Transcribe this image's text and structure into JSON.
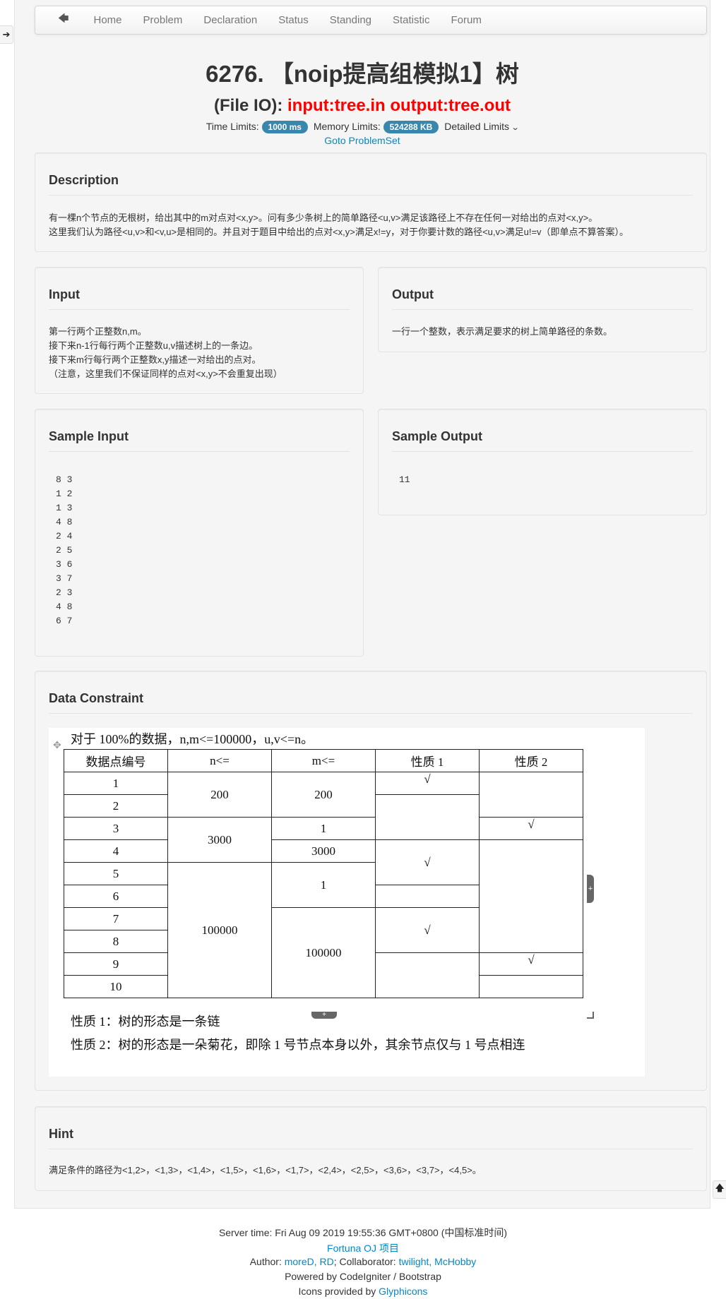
{
  "nav": {
    "back_icon": "arrow-left-icon",
    "items": [
      "Home",
      "Problem",
      "Declaration",
      "Status",
      "Standing",
      "Statistic",
      "Forum"
    ]
  },
  "side": {
    "left_icon": "arrow-right-icon",
    "right_icon": "arrow-up-icon"
  },
  "header": {
    "title": "6276. 【noip提高组模拟1】树",
    "fileio_prefix": "(File IO): ",
    "fileio_value": "input:tree.in output:tree.out",
    "time_label": "Time Limits:",
    "time_value": "1000 ms",
    "memory_label": "Memory Limits:",
    "memory_value": "524288 KB",
    "detailed_label": "Detailed Limits",
    "goto": "Goto ProblemSet"
  },
  "description": {
    "heading": "Description",
    "lines": [
      "有一棵n个节点的无根树，给出其中的m对点对<x,y>。问有多少条树上的简单路径<u,v>满足该路径上不存在任何一对给出的点对<x,y>。",
      "这里我们认为路径<u,v>和<v,u>是相同的。并且对于题目中给出的点对<x,y>满足x!=y，对于你要计数的路径<u,v>满足u!=v（即单点不算答案）。"
    ]
  },
  "input": {
    "heading": "Input",
    "lines": [
      "第一行两个正整数n,m。",
      "接下来n-1行每行两个正整数u,v描述树上的一条边。",
      "接下来m行每行两个正整数x,y描述一对给出的点对。",
      "（注意，这里我们不保证同样的点对<x,y>不会重复出现）"
    ]
  },
  "output": {
    "heading": "Output",
    "text": "一行一个整数，表示满足要求的树上简单路径的条数。"
  },
  "sample_input": {
    "heading": "Sample Input",
    "text": "8 3\n1 2\n1 3\n4 8\n2 4\n2 5\n3 6\n3 7\n2 3\n4 8\n6 7"
  },
  "sample_output": {
    "heading": "Sample Output",
    "text": "11"
  },
  "constraint": {
    "heading": "Data Constraint",
    "intro": "对于 100%的数据，n,m<=100000，u,v<=n。",
    "headers": [
      "数据点编号",
      "n<=",
      "m<=",
      "性质 1",
      "性质 2"
    ],
    "rows": [
      "1",
      "2",
      "3",
      "4",
      "5",
      "6",
      "7",
      "8",
      "9",
      "10"
    ],
    "n_vals": [
      "200",
      "3000",
      "100000"
    ],
    "m_vals": [
      "200",
      "1",
      "3000",
      "1",
      "100000"
    ],
    "check": "√",
    "prop1": "性质 1：树的形态是一条链",
    "prop2": "性质 2：树的形态是一朵菊花，即除 1 号节点本身以外，其余节点仅与 1 号点相连"
  },
  "hint": {
    "heading": "Hint",
    "text": "满足条件的路径为<1,2>，<1,3>，<1,4>，<1,5>，<1,6>，<1,7>，<2,4>，<2,5>，<3,6>，<3,7>，<4,5>。"
  },
  "footer": {
    "server_time": "Server time: Fri Aug 09 2019 19:55:36 GMT+0800 (中国标准时间)",
    "project": "Fortuna OJ 项目",
    "author_label": "Author: ",
    "authors": "moreD, RD",
    "collab_label": "; Collaborator: ",
    "collaborators": "twilight, McHobby",
    "powered": "Powered by CodeIgniter / Bootstrap",
    "icons_label": "Icons provided by ",
    "icons_link": "Glyphicons"
  }
}
